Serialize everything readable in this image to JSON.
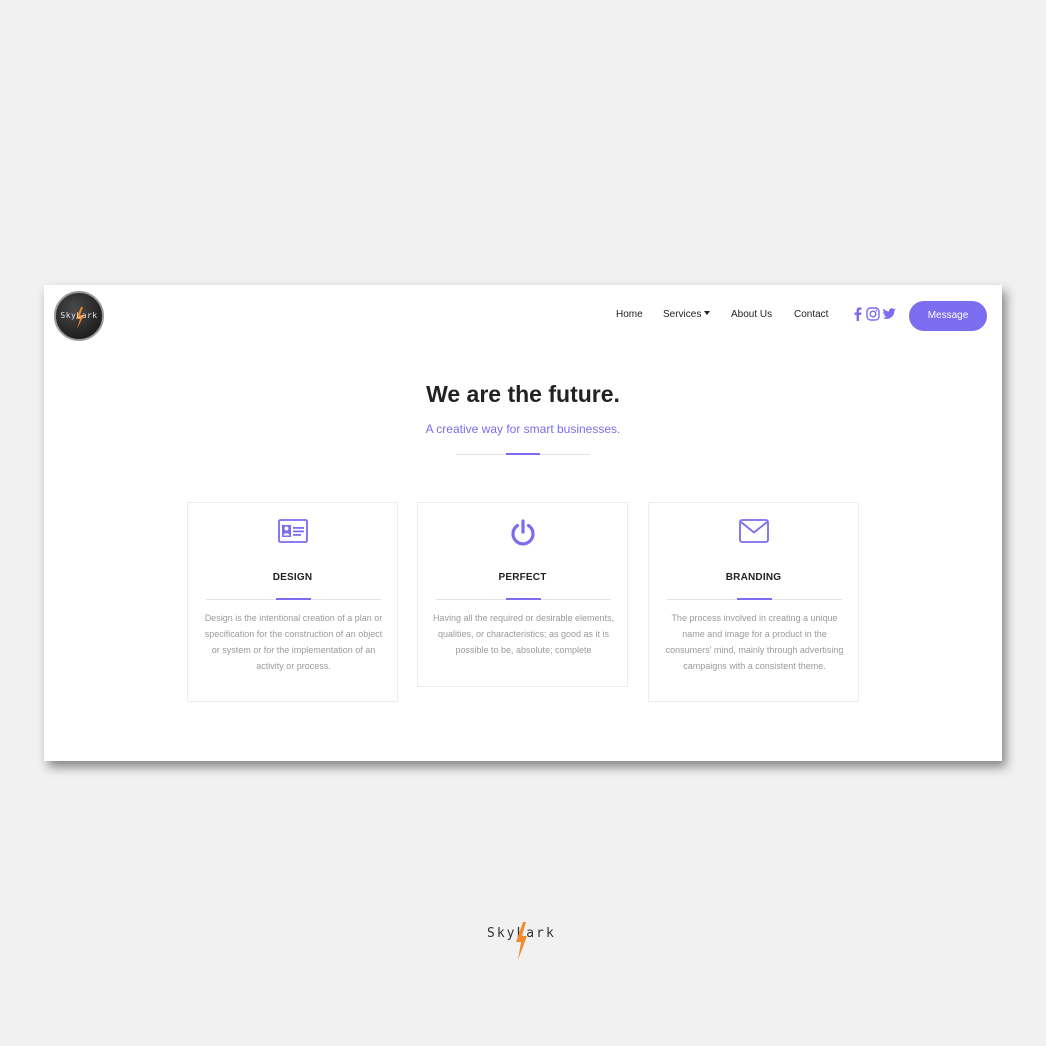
{
  "brand": {
    "name": "SkyLark",
    "accent": "#7b6cf0",
    "bolt_color": "#f28a2e"
  },
  "nav": {
    "items": [
      {
        "label": "Home"
      },
      {
        "label": "Services"
      },
      {
        "label": "About Us"
      },
      {
        "label": "Contact"
      }
    ],
    "social": [
      "facebook-icon",
      "instagram-icon",
      "twitter-icon"
    ],
    "cta_label": "Message"
  },
  "hero": {
    "title": "We are the future.",
    "subtitle": "A creative way for smart businesses."
  },
  "cards": [
    {
      "icon": "id-card-icon",
      "title": "DESIGN",
      "description": "Design is the intentional creation of a plan or specification for the construction of an object or system or for the implementation of an activity or process."
    },
    {
      "icon": "power-icon",
      "title": "PERFECT",
      "description": "Having all the required or desirable elements, qualities, or characteristics; as good as it is possible to be, absolute; complete"
    },
    {
      "icon": "envelope-icon",
      "title": "BRANDING",
      "description": "The process involved in creating a unique name and image for a product in the consumers' mind, mainly through advertising campaigns with a consistent theme."
    }
  ]
}
